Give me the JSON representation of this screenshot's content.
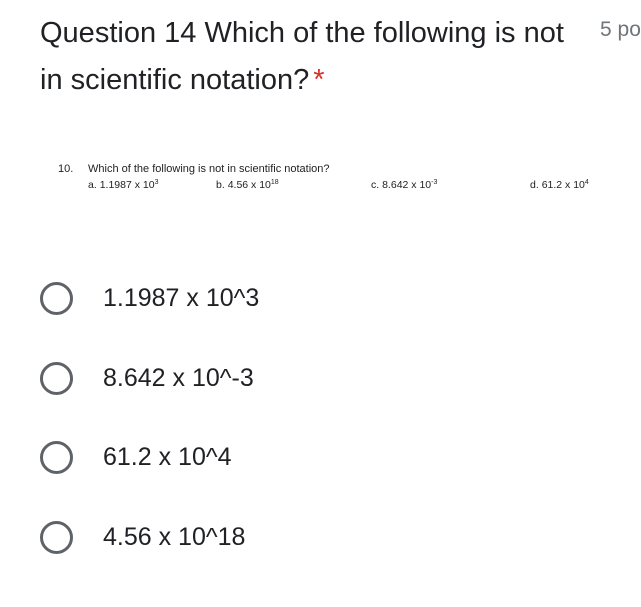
{
  "question": {
    "title": "Question 14 Which of the following is not in scientific notation?",
    "required_mark": "*",
    "points": "5 po"
  },
  "question_image": {
    "number": "10.",
    "stem": "Which of the following is not in scientific notation?",
    "options": [
      {
        "prefix": "a.",
        "mantissa": "1.1987 x 10",
        "exp": "3"
      },
      {
        "prefix": "b.",
        "mantissa": "4.56 x 10",
        "exp": "18"
      },
      {
        "prefix": "c.",
        "mantissa": "8.642 x 10",
        "exp": "-3"
      },
      {
        "prefix": "d.",
        "mantissa": "61.2 x 10",
        "exp": "4"
      }
    ]
  },
  "options": [
    {
      "label": "1.1987 x 10^3"
    },
    {
      "label": "8.642 x 10^-3"
    },
    {
      "label": "61.2 x 10^4"
    },
    {
      "label": "4.56 x 10^18"
    }
  ]
}
